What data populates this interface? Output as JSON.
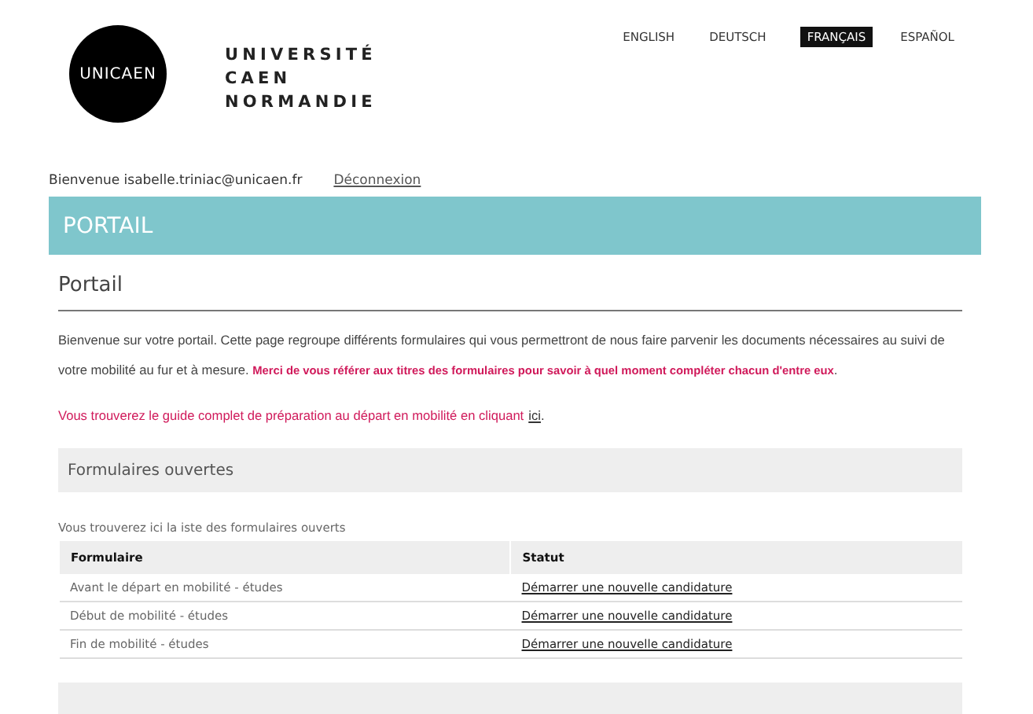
{
  "header": {
    "logo_text": "UNICAEN",
    "university_name": [
      "UNIVERSITÉ",
      "CAEN",
      "NORMANDIE"
    ],
    "languages": [
      {
        "label": "ENGLISH",
        "selected": false
      },
      {
        "label": "DEUTSCH",
        "selected": false
      },
      {
        "label": "FRANÇAIS",
        "selected": true
      },
      {
        "label": "ESPAÑOL",
        "selected": false
      }
    ]
  },
  "user_bar": {
    "welcome": "Bienvenue isabelle.triniac@unicaen.fr",
    "logout": "Déconnexion"
  },
  "banner": {
    "title": "PORTAIL"
  },
  "page": {
    "title": "Portail",
    "intro": "Bienvenue sur votre portail. Cette page regroupe différents formulaires qui vous permettront de nous faire parvenir les documents nécessaires au suivi de votre mobilité au fur et à mesure. **Merci de vous référer aux titres des formulaires pour savoir à quel moment compléter chacun d'entre eux**.",
    "guide_text": "Vous trouverez le guide complet de préparation au départ en mobilité en cliquant",
    "guide_link": "ici",
    "guide_end": "."
  },
  "open_forms": {
    "title": "Formulaires ouvertes",
    "description": "Vous trouverez ici la iste des formulaires ouverts",
    "table": {
      "columns": [
        "Formulaire",
        "Statut"
      ],
      "rows": [
        {
          "form": "Avant le départ en mobilité - études",
          "status": "Démarrer une nouvelle candidature"
        },
        {
          "form": "Début de mobilité - études",
          "status": "Démarrer une nouvelle candidature"
        },
        {
          "form": "Fin de mobilité - études",
          "status": "Démarrer une nouvelle candidature"
        }
      ]
    }
  }
}
